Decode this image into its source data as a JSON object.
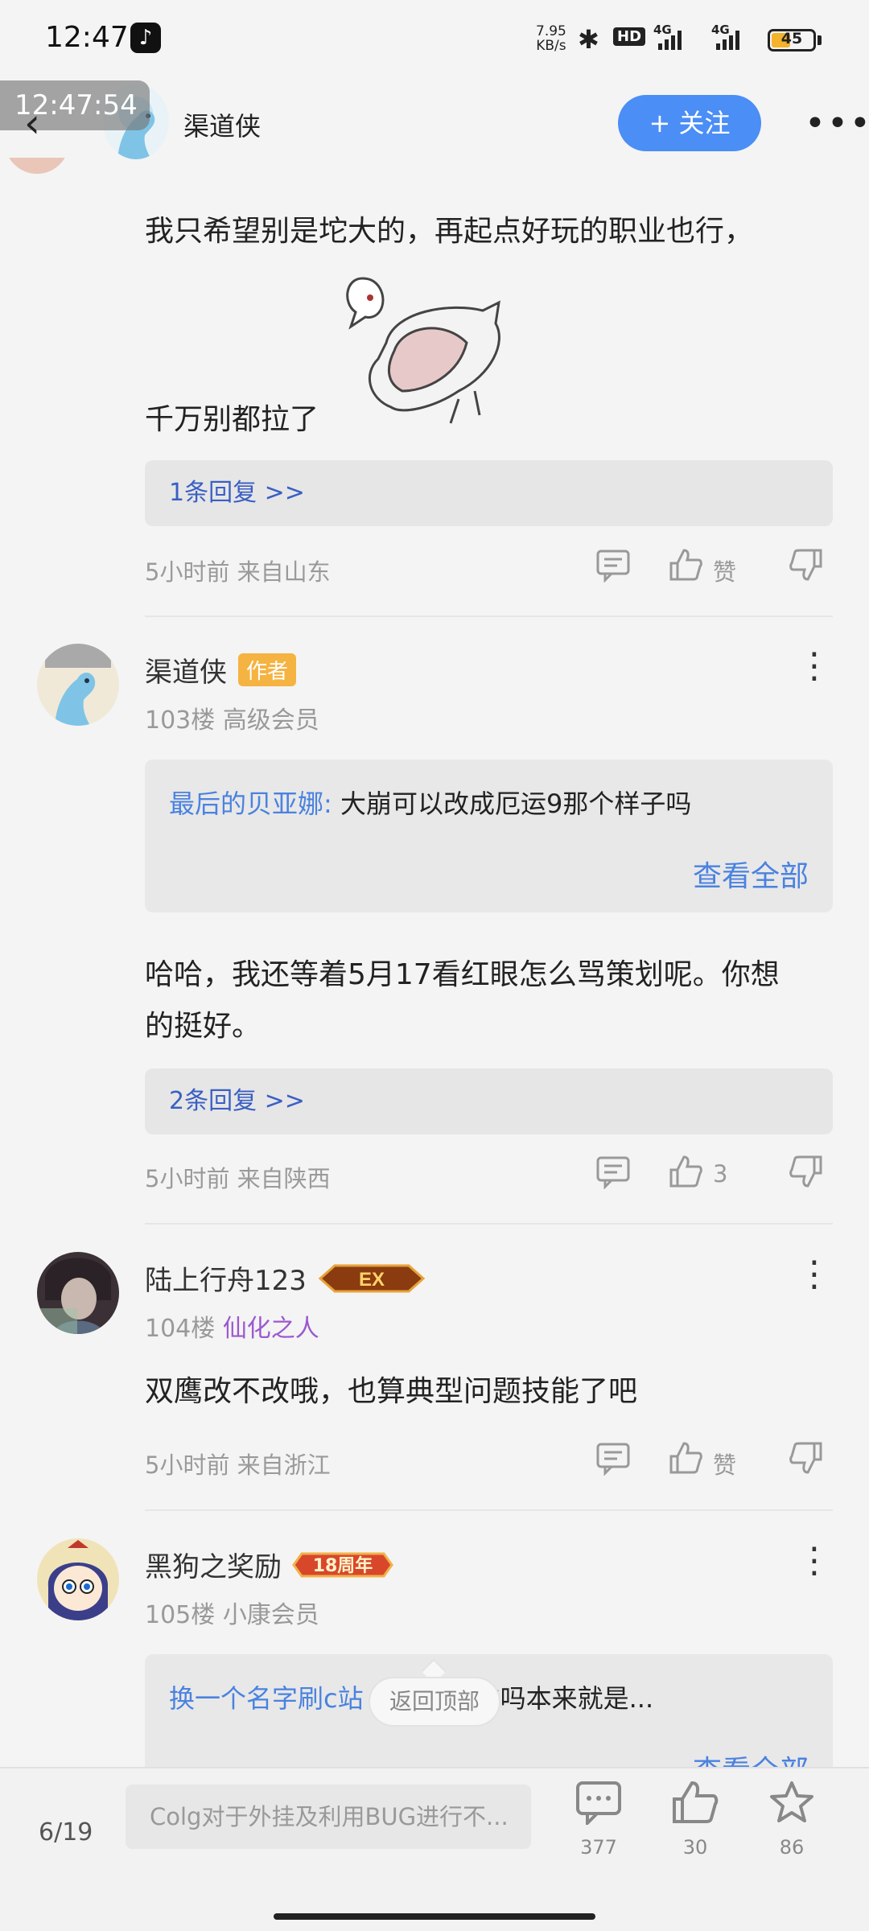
{
  "status_bar": {
    "time": "12:47",
    "net_speed_value": "7.95",
    "net_speed_unit": "KB/s",
    "hd_label": "HD",
    "sim1_label": "4G",
    "sim2_label": "4G",
    "battery_level": "45",
    "battery_fraction": 0.45
  },
  "header": {
    "timestamp_overlay": "12:47:54",
    "author_name": "渠道侠",
    "follow_label": "+ 关注",
    "more_glyph": "•••"
  },
  "comments": [
    {
      "text_line1": "我只希望别是坨大的，再起点好玩的职业也行，",
      "text_line2": "千万别都拉了",
      "reply_link": "1条回复 >>",
      "meta": "5小时前 来自山东",
      "like_label": "赞"
    },
    {
      "username": "渠道侠",
      "author_badge": "作者",
      "floor": "103楼",
      "rank": "高级会员",
      "quote_name": "最后的贝亚娜:",
      "quote_text": "大崩可以改成厄运9那个样子吗",
      "view_all": "查看全部",
      "text_line1": "哈哈，我还等着5月17看红眼怎么骂策划呢。你想",
      "text_line2": "的挺好。",
      "reply_link": "2条回复 >>",
      "meta": "5小时前 来自陕西",
      "like_count": "3"
    },
    {
      "username": "陆上行舟123",
      "badge_text": "EX",
      "floor": "104楼",
      "rank": "仙化之人",
      "text": "双鹰改不改哦，也算典型问题技能了吧",
      "meta": "5小时前 来自浙江",
      "like_label": "赞"
    },
    {
      "username": "黑狗之奖励",
      "badge_text": "18周年",
      "floor": "105楼",
      "rank": "小康会员",
      "quote_name": "换一个名字刷c站",
      "quote_text": "不是负优化吗本来就是...",
      "view_all": "查看全部"
    }
  ],
  "back_to_top": "返回顶部",
  "bottom_bar": {
    "page_count": "6/19",
    "post_title": "Colg对于外挂及利用BUG进行不...",
    "comment_count": "377",
    "like_count": "30",
    "star_count": "86"
  },
  "colors": {
    "accent": "#4a8ef6",
    "link": "#3a5fc4",
    "author_badge": "#f5b342",
    "rank_purple": "#9b59d0"
  }
}
